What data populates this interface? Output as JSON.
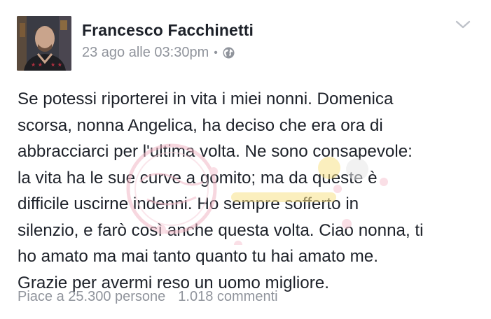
{
  "post": {
    "author": "Francesco Facchinetti",
    "timestamp": "23 ago alle 03:30pm",
    "separator": "•",
    "privacy_icon": "globe-icon",
    "menu_icon": "chevron-down-icon",
    "text_lines": [
      "Se potessi riporterei in vita i miei nonni. Domenica",
      "scorsa, nonna Angelica, ha deciso che era ora di",
      "abbracciarci per l'ultima volta. Ne sono consapevole:",
      "la vita ha le sue curve a gomito; ma da queste è",
      "difficile uscirne indenni. Ho sempre sofferto in",
      "silenzio, e farò così anche questa volta. Ciao nonna, ti",
      "ho amato ma mai tanto quanto tu hai amato me.",
      "Grazie per avermi reso un uomo migliore."
    ],
    "likes": "Piace a 25.300 persone",
    "comments": "1.018 commenti"
  },
  "colors": {
    "text": "#1d2129",
    "secondary": "#90949c",
    "background": "#ffffff"
  }
}
